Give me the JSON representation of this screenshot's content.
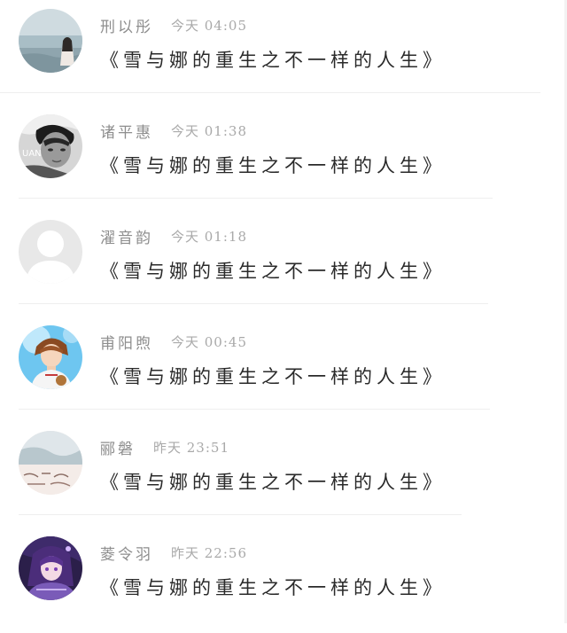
{
  "comments": [
    {
      "name": "刑以彤",
      "time": "今天 04:05",
      "content": "《雪与娜的重生之不一样的人生》",
      "avatar_icon": "avatar-seaside-girl-icon"
    },
    {
      "name": "诸平惠",
      "time": "今天 01:38",
      "content": "《雪与娜的重生之不一样的人生》",
      "avatar_icon": "avatar-bw-portrait-icon"
    },
    {
      "name": "濯音韵",
      "time": "今天 01:18",
      "content": "《雪与娜的重生之不一样的人生》",
      "avatar_icon": "avatar-default-placeholder-icon"
    },
    {
      "name": "甫阳煦",
      "time": "今天 00:45",
      "content": "《雪与娜的重生之不一样的人生》",
      "avatar_icon": "avatar-anime-boy-icon"
    },
    {
      "name": "郦磐",
      "time": "昨天 23:51",
      "content": "《雪与娜的重生之不一样的人生》",
      "avatar_icon": "avatar-handwriting-photo-icon"
    },
    {
      "name": "菱令羽",
      "time": "昨天 22:56",
      "content": "《雪与娜的重生之不一样的人生》",
      "avatar_icon": "avatar-anime-purple-icon"
    }
  ],
  "colors": {
    "name": "#8e8e8e",
    "time": "#a9a9a9",
    "content": "#2a2a2a",
    "divider": "#efefef",
    "background": "#ffffff"
  }
}
